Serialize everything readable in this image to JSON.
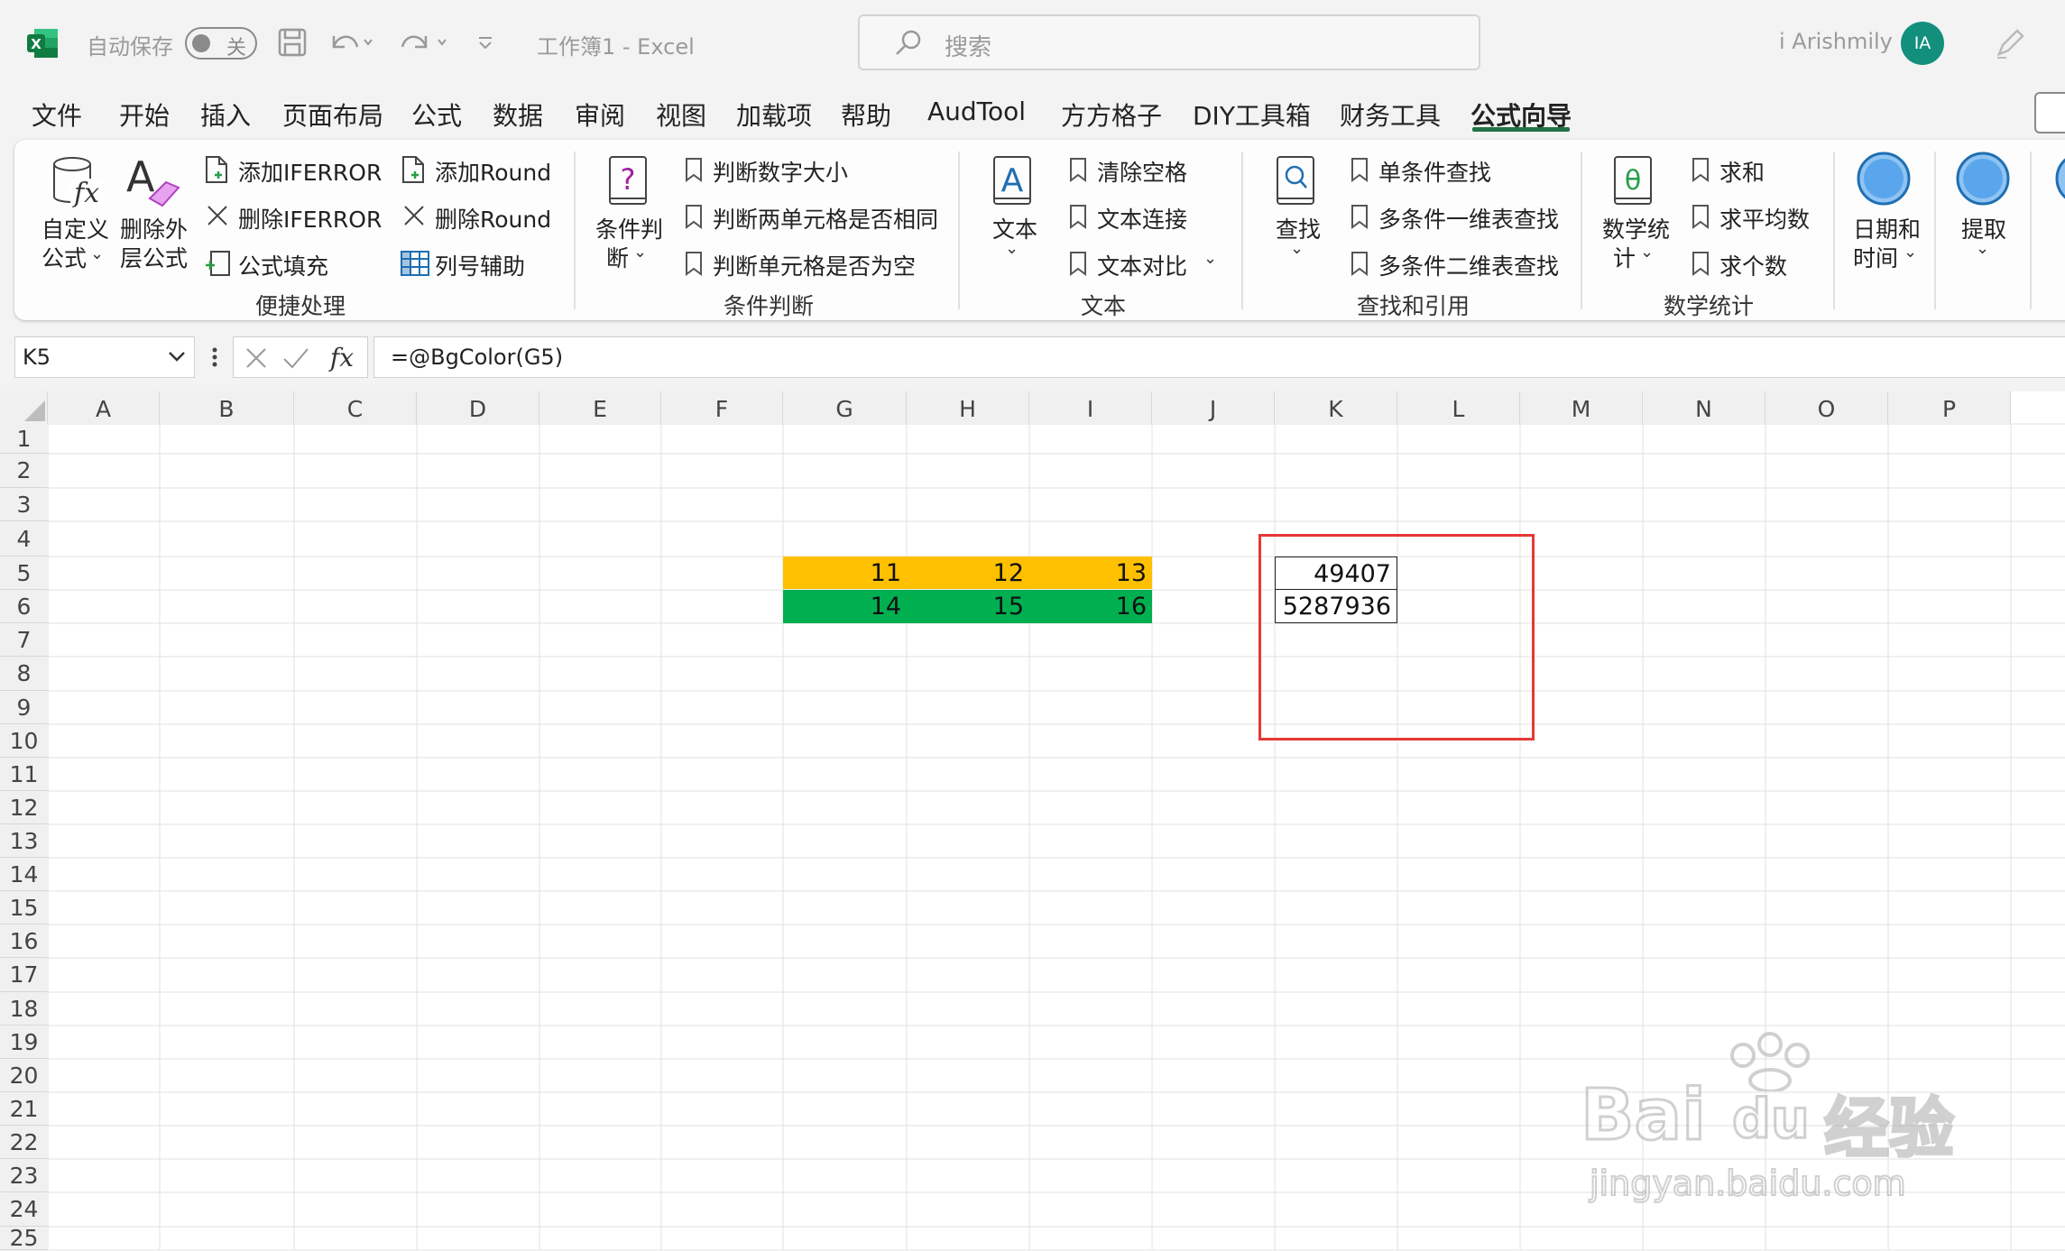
{
  "titlebar": {
    "autosave_label": "自动保存",
    "toggle_state": "关",
    "workbook_title": "工作簿1  -  Excel",
    "search_placeholder": "搜索",
    "user_name": "i Arishmily",
    "avatar_initials": "IA"
  },
  "menu": {
    "items": [
      "文件",
      "开始",
      "插入",
      "页面布局",
      "公式",
      "数据",
      "审阅",
      "视图",
      "加载项",
      "帮助",
      "AudTool",
      "方方格子",
      "DIY工具箱",
      "财务工具",
      "公式向导"
    ],
    "active": "公式向导"
  },
  "ribbon": {
    "custom_formula": [
      "自定义",
      "公式"
    ],
    "delete_outer": [
      "删除外",
      "层公式"
    ],
    "add_iferror": "添加IFERROR",
    "del_iferror": "删除IFERROR",
    "formula_fill": "公式填充",
    "add_round": "添加Round",
    "del_round": "删除Round",
    "col_assist": "列号辅助",
    "group_quick": "便捷处理",
    "cond_judge": [
      "条件判",
      "断"
    ],
    "judge_size": "判断数字大小",
    "judge_same": "判断两单元格是否相同",
    "judge_empty": "判断单元格是否为空",
    "group_cond": "条件判断",
    "text_btn": "文本",
    "clear_space": "清除空格",
    "text_join": "文本连接",
    "text_compare": "文本对比",
    "group_text": "文本",
    "lookup_btn": "查找",
    "single_lookup": "单条件查找",
    "multi_1d": "多条件一维表查找",
    "multi_2d": "多条件二维表查找",
    "group_lookup": "查找和引用",
    "math_stats": [
      "数学统",
      "计"
    ],
    "sum": "求和",
    "average": "求平均数",
    "count": "求个数",
    "group_math": "数学统计",
    "datetime": [
      "日期和",
      "时间"
    ],
    "extract": "提取"
  },
  "formula_bar": {
    "name_box": "K5",
    "formula": "=@BgColor(G5)"
  },
  "sheet": {
    "columns": [
      "A",
      "B",
      "C",
      "D",
      "E",
      "F",
      "G",
      "H",
      "I",
      "J",
      "K",
      "L",
      "M",
      "N",
      "O",
      "P"
    ],
    "rows": [
      "1",
      "2",
      "3",
      "4",
      "5",
      "6",
      "7",
      "8",
      "9",
      "10",
      "11",
      "12",
      "13",
      "14",
      "15",
      "16",
      "17",
      "18",
      "19",
      "20",
      "21",
      "22",
      "23",
      "24",
      "25"
    ],
    "row5_values": [
      "11",
      "12",
      "13"
    ],
    "row6_values": [
      "14",
      "15",
      "16"
    ],
    "k5": "49407",
    "k6": "5287936",
    "row5_color": "#ffc000",
    "row6_color": "#00b050",
    "highlight_color": "#e53935"
  },
  "watermark": {
    "brand": "Bai",
    "brand2": "du",
    "brand_cn": "经验",
    "url": "jingyan.baidu.com"
  }
}
